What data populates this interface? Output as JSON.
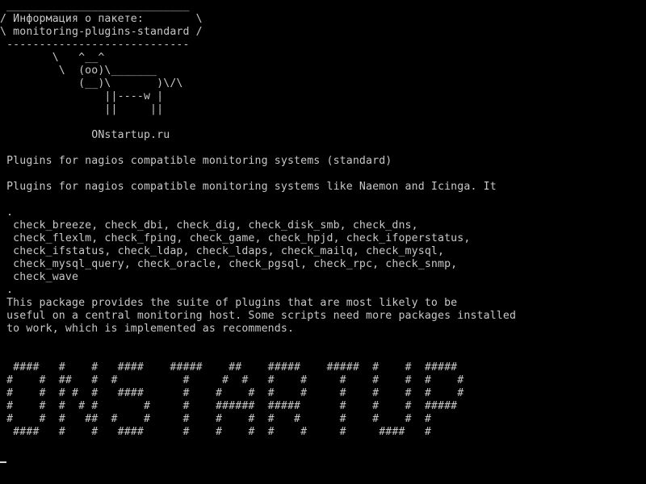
{
  "terminal": {
    "background": "#000000",
    "foreground": "#c8c8c8",
    "cursor_color": "#d8d8d8",
    "lines": [
      " ____________________________",
      "/ Информация о пакете:        \\",
      "\\ monitoring-plugins-standard /",
      " ----------------------------",
      "        \\   ^__^",
      "         \\  (oo)\\_______",
      "            (__)\\       )\\/\\",
      "                ||----w |",
      "                ||     ||",
      "",
      "              ONstartup.ru",
      "",
      " Plugins for nagios compatible monitoring systems (standard)",
      "",
      " Plugins for nagios compatible monitoring systems like Naemon and Icinga. It",
      "",
      " .",
      "  check_breeze, check_dbi, check_dig, check_disk_smb, check_dns,",
      "  check_flexlm, check_fping, check_game, check_hpjd, check_ifoperstatus,",
      "  check_ifstatus, check_ldap, check_ldaps, check_mailq, check_mysql,",
      "  check_mysql_query, check_oracle, check_pgsql, check_rpc, check_snmp,",
      "  check_wave",
      " .",
      " This package provides the suite of plugins that are most likely to be",
      " useful on a central monitoring host. Some scripts need more packages installed",
      " to work, which is implemented as recommends.",
      "",
      "",
      "  ####   #    #   ####    #####    ##    #####    #####  #    #  #####",
      " #    #  ##   #  #          #     #  #   #    #     #    #    #  #    #",
      " #    #  # #  #   ####      #    #    #  #    #     #    #    #  #    #",
      " #    #  #  # #       #     #    ######  #####      #    #    #  #####",
      " #    #  #   ##  #    #     #    #    #  #   #      #    #    #  #",
      "  ####   #    #   ####      #    #    #  #    #     #     ####   #"
    ]
  }
}
